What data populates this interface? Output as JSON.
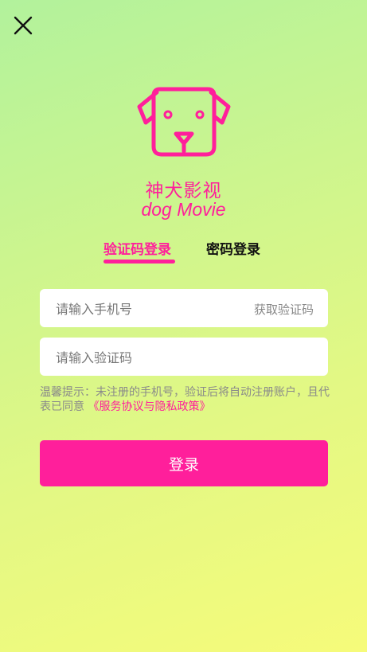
{
  "header": {
    "close_icon": "close-icon"
  },
  "brand": {
    "logo_icon": "dog-face-icon",
    "name": "神犬影视",
    "subtitle": "dog Movie",
    "accent_color": "#ff1f9b"
  },
  "tabs": [
    {
      "label": "验证码登录",
      "active": true
    },
    {
      "label": "密码登录",
      "active": false
    }
  ],
  "form": {
    "phone_placeholder": "请输入手机号",
    "get_code_label": "获取验证码",
    "code_placeholder": "请输入验证码"
  },
  "notice": {
    "text": "温馨提示：未注册的手机号，验证后将自动注册账户，且代表已同意",
    "policy_link": "《服务协议与隐私政策》"
  },
  "login_button_label": "登录"
}
